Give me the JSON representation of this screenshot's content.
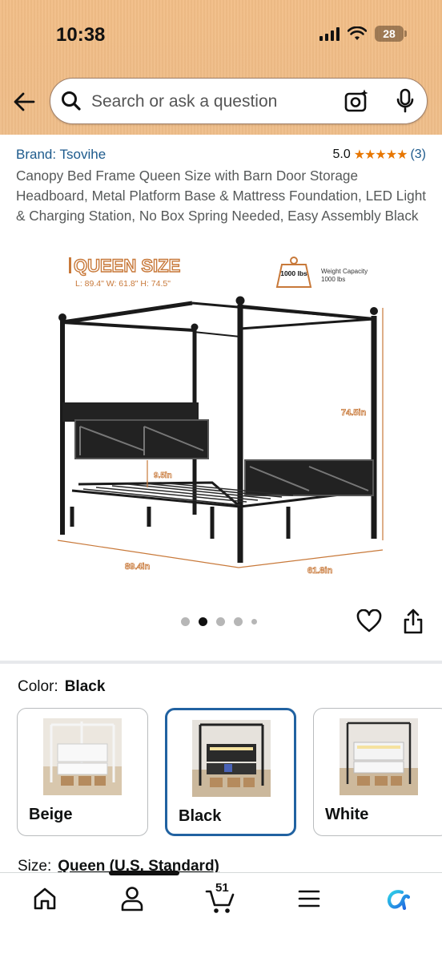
{
  "status_bar": {
    "time": "10:38",
    "battery": "28"
  },
  "header": {
    "search_placeholder": "Search or ask a question"
  },
  "product": {
    "brand": "Brand: Tsovihe",
    "rating_value": "5.0",
    "stars": "★★★★★",
    "rating_count": "(3)",
    "title": "Canopy Bed Frame Queen Size with Barn Door Storage Headboard, Metal Platform Base & Mattress Foundation, LED Light & Charging Station, No Box Spring Needed, Easy Assembly Black"
  },
  "image": {
    "heading": "QUEEN SIZE",
    "dimensions": "L: 89.4\"  W: 61.8\"  H: 74.5\"",
    "weight_badge": "1000 lbs",
    "weight_caption_1": "Weight Capacity",
    "weight_caption_2": "1000 lbs",
    "height_label": "74.5in",
    "clearance_label": "9.5in",
    "length_label": "89.4in",
    "width_label": "61.8in",
    "carousel_total": 5,
    "carousel_active": 2
  },
  "color": {
    "label": "Color:",
    "selected": "Black",
    "options": [
      {
        "label": "Beige"
      },
      {
        "label": "Black"
      },
      {
        "label": "White"
      }
    ]
  },
  "size": {
    "label": "Size:",
    "value": "Queen (U.S. Standard)"
  },
  "bottom_nav": {
    "cart_count": "51"
  },
  "colors": {
    "accent_blue": "#2162a1",
    "link_blue": "#1d5a8c",
    "star_orange": "#e77600",
    "header_bg": "#efbc86"
  }
}
